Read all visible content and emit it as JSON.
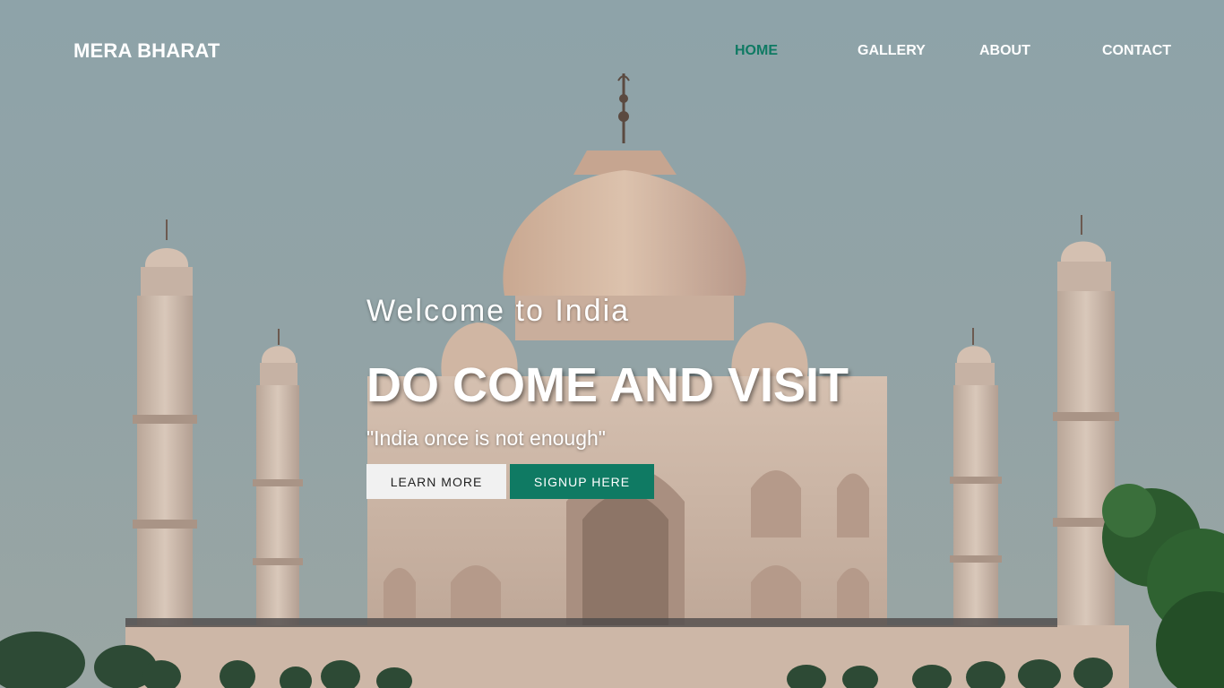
{
  "brand": {
    "name": "MERA BHARAT"
  },
  "nav": {
    "items": [
      {
        "label": "HOME",
        "active": true
      },
      {
        "label": "GALLERY",
        "active": false
      },
      {
        "label": "ABOUT",
        "active": false
      },
      {
        "label": "CONTACT",
        "active": false
      }
    ]
  },
  "hero": {
    "welcome": "Welcome to India",
    "headline": "DO COME AND VISIT",
    "tagline": "\"India once is not enough\"",
    "buttons": {
      "learn_more": "LEARN MORE",
      "signup": "SIGNUP HERE"
    },
    "background_image": "taj-mahal-photo"
  },
  "colors": {
    "accent": "#0f7a63",
    "sky": "#8fa3a8",
    "marble": "#d8c2b0"
  }
}
